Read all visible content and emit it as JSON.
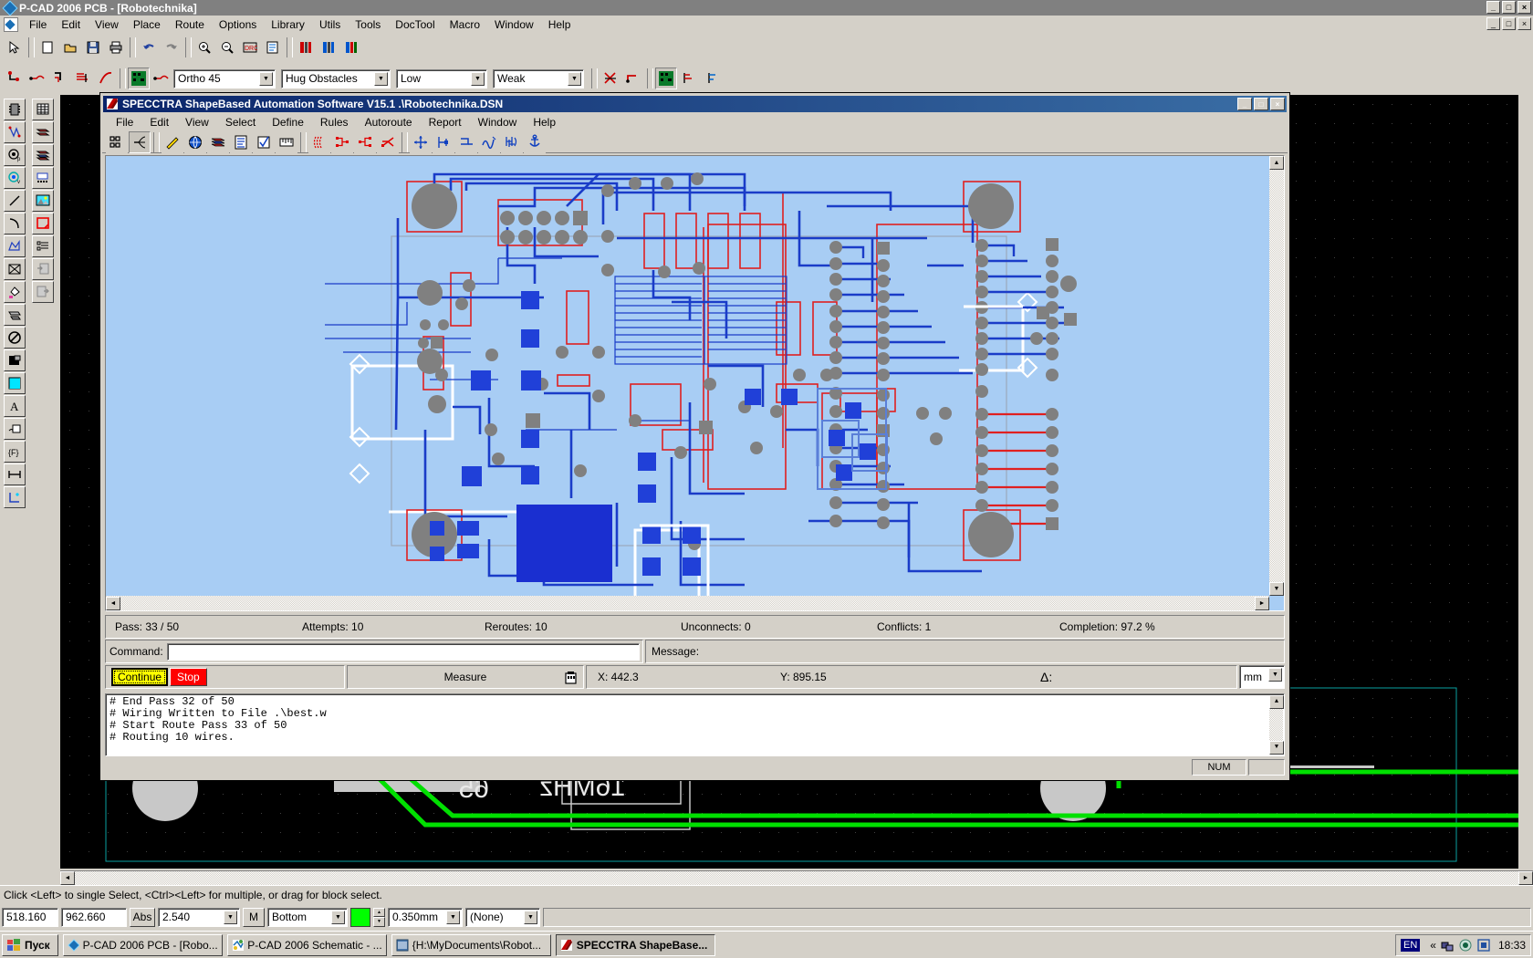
{
  "pcad": {
    "title": "P-CAD 2006 PCB - [Robotechnika]",
    "menu": [
      "File",
      "Edit",
      "View",
      "Place",
      "Route",
      "Options",
      "Library",
      "Utils",
      "Tools",
      "DocTool",
      "Macro",
      "Window",
      "Help"
    ],
    "window_buttons": [
      "_",
      "□",
      "×"
    ],
    "mdi_buttons": [
      "_",
      "□",
      "×"
    ],
    "toolbar_combos": [
      {
        "name": "route-mode",
        "value": "Ortho 45",
        "width": "112"
      },
      {
        "name": "obstacle-mode",
        "value": "Hug Obstacles",
        "width": "120"
      },
      {
        "name": "priority",
        "value": "Low",
        "width": "100"
      },
      {
        "name": "strength",
        "value": "Weak",
        "width": "100"
      }
    ],
    "statusbar_hint": "Click <Left> to single Select, <Ctrl><Left> for multiple, or drag for block select.",
    "bottom": {
      "x_value": "518.160",
      "y_value": "962.660",
      "abs_label": "Abs",
      "grid_value": "2.540",
      "m_label": "M",
      "layer_value": "Bottom",
      "layer_color": "#00ff00",
      "width_value": "0.350mm",
      "net_value": "(None)"
    }
  },
  "spectra": {
    "title": "SPECCTRA ShapeBased Automation Software V15.1 .\\Robotechnika.DSN",
    "window_buttons": [
      "_",
      "□",
      "×"
    ],
    "menu": [
      "File",
      "Edit",
      "View",
      "Select",
      "Define",
      "Rules",
      "Autoroute",
      "Report",
      "Window",
      "Help"
    ],
    "stats": [
      {
        "label": "Pass:",
        "value": "33 / 50",
        "name": "pass"
      },
      {
        "label": "Attempts:",
        "value": "10",
        "name": "attempts"
      },
      {
        "label": "Reroutes:",
        "value": "10",
        "name": "reroutes"
      },
      {
        "label": "Unconnects:",
        "value": "0",
        "name": "unconnects"
      },
      {
        "label": "Conflicts:",
        "value": "1",
        "name": "conflicts"
      },
      {
        "label": "Completion:",
        "value": "97.2  %",
        "name": "completion"
      }
    ],
    "pass_text": "Pass:  33 / 50",
    "attempts_text": "Attempts: 10",
    "reroutes_text": "Reroutes: 10",
    "unconnects_text": "Unconnects: 0",
    "conflicts_text": "Conflicts: 1",
    "completion_text": "Completion: 97.2  %",
    "command_label": "Command:",
    "command_value": "",
    "message_label": "Message:",
    "continue_label": "Continue",
    "stop_label": "Stop",
    "measure_label": "Measure",
    "x_label": "X: 442.3",
    "y_label": "Y: 895.15",
    "delta_label": "Δ:",
    "units_value": "mm",
    "log_lines": [
      "# End Pass 32 of 50",
      "# Wiring Written to File .\\best.w",
      "# Start Route Pass 33 of 50",
      "# Routing 10 wires."
    ],
    "status_num": "NUM",
    "colors": {
      "canvas_bg": "#a8cdf4",
      "trace_blue": "#1a3cc8",
      "trace_red": "#e01010",
      "pad_gray": "#808080",
      "outline_white": "#ffffff",
      "title_blue": "#0a246a",
      "continue_yellow": "#ffff00",
      "stop_red": "#ff0000"
    }
  },
  "taskbar": {
    "start_label": "Пуск",
    "items": [
      {
        "label": "P-CAD 2006 PCB - [Robo...",
        "icon": "pcad-pcb-icon",
        "active": false
      },
      {
        "label": "P-CAD 2006 Schematic - ...",
        "icon": "pcad-schematic-icon",
        "active": false
      },
      {
        "label": "{H:\\MyDocuments\\Robot...",
        "icon": "folder-icon",
        "active": false
      },
      {
        "label": "SPECCTRA ShapeBase...",
        "icon": "spectra-icon",
        "active": true
      }
    ],
    "lang": "EN",
    "clock": "18:33",
    "tray_chevron": "«"
  }
}
